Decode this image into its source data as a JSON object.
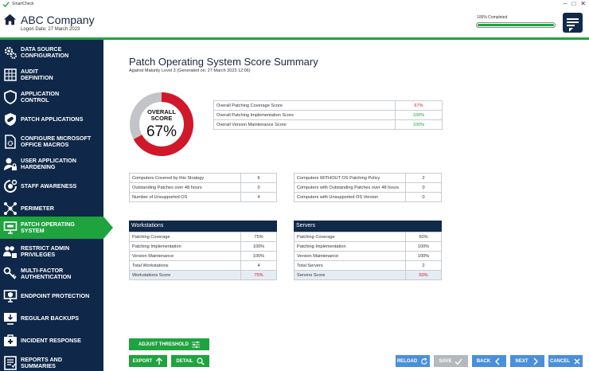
{
  "titlebar": {
    "app_name": "SmartCheck"
  },
  "header": {
    "company": "ABC Company",
    "logon": "Logon Date: 27 March 2023",
    "progress_label": "100% Completed",
    "progress": 1.0
  },
  "sidebar": {
    "items": [
      {
        "label": "Data Source\nConfiguration",
        "icon": "gears-icon"
      },
      {
        "label": "Audit\nDefinition",
        "icon": "audit-grid-icon"
      },
      {
        "label": "Application\nControl",
        "icon": "shield-icon"
      },
      {
        "label": "Patch Applications",
        "icon": "shield-bandage-icon"
      },
      {
        "label": "Configure Microsoft\nOffice Macros",
        "icon": "document-gear-icon"
      },
      {
        "label": "User Application\nHardening",
        "icon": "user-lock-icon"
      },
      {
        "label": "Staff Awareness",
        "icon": "brain-gear-icon"
      },
      {
        "label": "Perimeter",
        "icon": "network-icon"
      },
      {
        "label": "Patch Operating\nSystem",
        "icon": "monitor-patch-icon"
      },
      {
        "label": "Restrict Admin\nPrivileges",
        "icon": "users-lock-icon"
      },
      {
        "label": "Multi-Factor\nAuthentication",
        "icon": "keys-icon"
      },
      {
        "label": "Endpoint Protection",
        "icon": "monitor-shield-icon"
      },
      {
        "label": "Regular Backups",
        "icon": "backup-icon"
      },
      {
        "label": "Incident Response",
        "icon": "first-aid-icon"
      },
      {
        "label": "Reports and\nSummaries",
        "icon": "report-icon"
      }
    ],
    "active_index": 8
  },
  "main": {
    "title": "Patch Operating System Score Summary",
    "subtitle": "Against Maturity Level 3 (Generated on: 27 March 2023  12:06)",
    "overall": {
      "label": "OVERALL\nSCORE",
      "value": "67%",
      "fraction": 0.67
    },
    "scores": [
      {
        "label": "Overall Patching Coverage Score",
        "value": "67%",
        "status": "red"
      },
      {
        "label": "Overall Patching Implementation Score",
        "value": "100%",
        "status": "green"
      },
      {
        "label": "Overall Version Maintenance Score",
        "value": "100%",
        "status": "green"
      }
    ],
    "computers_left": [
      {
        "label": "Computers Covered by this Strategy",
        "value": "6"
      },
      {
        "label": "Outstanding Patches over 48 hours",
        "value": "0"
      },
      {
        "label": "Number of Unsupported OS",
        "value": "4"
      }
    ],
    "computers_right": [
      {
        "label": "Computers WITHOUT OS Patching Policy",
        "value": "2"
      },
      {
        "label": "Computers with Outstanding Patches over 48 hours",
        "value": "0"
      },
      {
        "label": "Computers with Unsupported OS Version",
        "value": "0"
      }
    ],
    "workstations": {
      "title": "Workstations",
      "rows": [
        {
          "label": "Patching Coverage",
          "value": "75%"
        },
        {
          "label": "Patching Implementation",
          "value": "100%"
        },
        {
          "label": "Version Maintenance",
          "value": "100%"
        },
        {
          "label": "Total Workstations",
          "value": "4"
        }
      ],
      "score": {
        "label": "Workstations Score",
        "value": "75%"
      }
    },
    "servers": {
      "title": "Servers",
      "rows": [
        {
          "label": "Patching Coverage",
          "value": "50%"
        },
        {
          "label": "Patching Implementation",
          "value": "100%"
        },
        {
          "label": "Version Maintenance",
          "value": "100%"
        },
        {
          "label": "Total Servers",
          "value": "2"
        }
      ],
      "score": {
        "label": "Servers Score",
        "value": "50%"
      }
    }
  },
  "buttons": {
    "adjust_threshold": "ADJUST THRESHOLD",
    "export": "EXPORT",
    "detail": "DETAIL",
    "reload": "RELOAD",
    "save": "SAVE",
    "back": "BACK",
    "next": "NEXT",
    "cancel": "CANCEL"
  },
  "colors": {
    "navy": "#0f2849",
    "green": "#1fa33f",
    "red": "#d1182a",
    "blue": "#4a90d9",
    "grey": "#b5b9be"
  }
}
